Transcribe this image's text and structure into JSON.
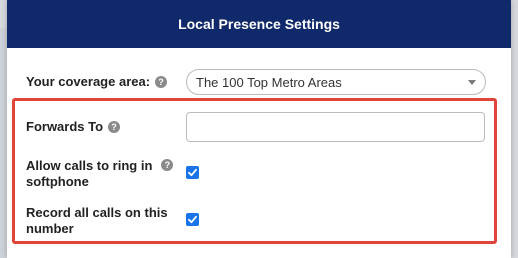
{
  "modal": {
    "title": "Local Presence Settings"
  },
  "coverage": {
    "label": "Your coverage area:",
    "help": "?",
    "selected": "The 100 Top Metro Areas"
  },
  "forwards": {
    "label": "Forwards To",
    "help": "?",
    "value": ""
  },
  "softphone": {
    "label_line1": "Allow calls to ring in",
    "label_line2": "softphone",
    "help": "?",
    "checked": true
  },
  "record": {
    "label_line1": "Record all calls on this",
    "label_line2": "number",
    "checked": true
  },
  "colors": {
    "header": "#10296a",
    "highlight": "#e3443a",
    "checkbox": "#1a73e8"
  }
}
